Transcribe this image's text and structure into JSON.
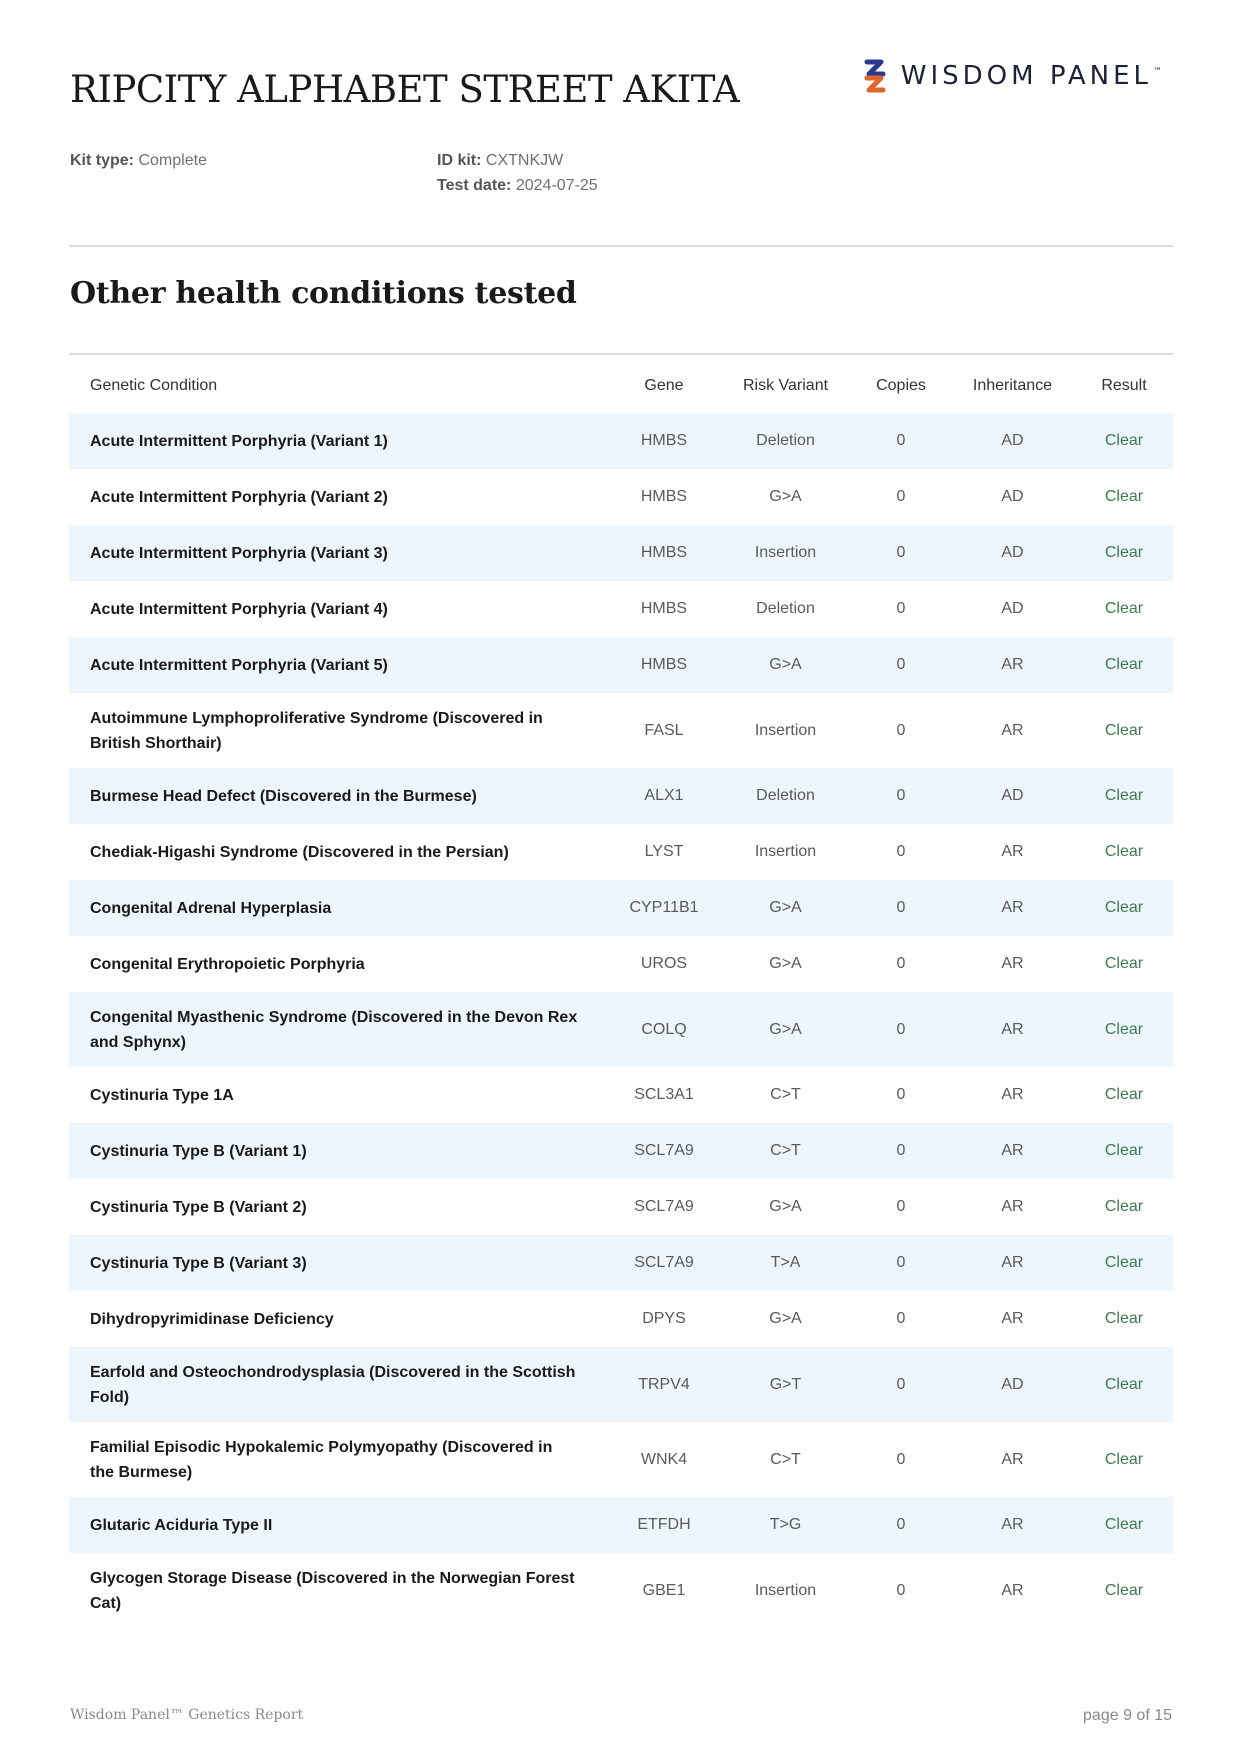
{
  "header": {
    "pet_name": "RIPCITY ALPHABET STREET AKITA",
    "logo_text": "WISDOM PANEL",
    "logo_tm": "™",
    "logo_icon": "wisdom-panel-logo-mark"
  },
  "meta": {
    "kit_type_label": "Kit type:",
    "kit_type_value": "Complete",
    "id_kit_label": "ID kit:",
    "id_kit_value": "CXTNKJW",
    "test_date_label": "Test date:",
    "test_date_value": "2024-07-25"
  },
  "section": {
    "title": "Other health conditions tested"
  },
  "table": {
    "headers": {
      "condition": "Genetic Condition",
      "gene": "Gene",
      "risk_variant": "Risk Variant",
      "copies": "Copies",
      "inheritance": "Inheritance",
      "result": "Result"
    },
    "rows": [
      {
        "condition": "Acute Intermittent Porphyria (Variant 1)",
        "gene": "HMBS",
        "risk_variant": "Deletion",
        "copies": "0",
        "inheritance": "AD",
        "result": "Clear"
      },
      {
        "condition": "Acute Intermittent Porphyria (Variant 2)",
        "gene": "HMBS",
        "risk_variant": "G>A",
        "copies": "0",
        "inheritance": "AD",
        "result": "Clear"
      },
      {
        "condition": "Acute Intermittent Porphyria (Variant 3)",
        "gene": "HMBS",
        "risk_variant": "Insertion",
        "copies": "0",
        "inheritance": "AD",
        "result": "Clear"
      },
      {
        "condition": "Acute Intermittent Porphyria (Variant 4)",
        "gene": "HMBS",
        "risk_variant": "Deletion",
        "copies": "0",
        "inheritance": "AD",
        "result": "Clear"
      },
      {
        "condition": "Acute Intermittent Porphyria (Variant 5)",
        "gene": "HMBS",
        "risk_variant": "G>A",
        "copies": "0",
        "inheritance": "AR",
        "result": "Clear"
      },
      {
        "condition": "Autoimmune Lymphoproliferative Syndrome (Discovered in British Shorthair)",
        "gene": "FASL",
        "risk_variant": "Insertion",
        "copies": "0",
        "inheritance": "AR",
        "result": "Clear"
      },
      {
        "condition": "Burmese Head Defect (Discovered in the Burmese)",
        "gene": "ALX1",
        "risk_variant": "Deletion",
        "copies": "0",
        "inheritance": "AD",
        "result": "Clear"
      },
      {
        "condition": "Chediak-Higashi Syndrome (Discovered in the Persian)",
        "gene": "LYST",
        "risk_variant": "Insertion",
        "copies": "0",
        "inheritance": "AR",
        "result": "Clear"
      },
      {
        "condition": "Congenital Adrenal Hyperplasia",
        "gene": "CYP11B1",
        "risk_variant": "G>A",
        "copies": "0",
        "inheritance": "AR",
        "result": "Clear"
      },
      {
        "condition": "Congenital Erythropoietic Porphyria",
        "gene": "UROS",
        "risk_variant": "G>A",
        "copies": "0",
        "inheritance": "AR",
        "result": "Clear"
      },
      {
        "condition": "Congenital Myasthenic Syndrome (Discovered in the Devon Rex and Sphynx)",
        "gene": "COLQ",
        "risk_variant": "G>A",
        "copies": "0",
        "inheritance": "AR",
        "result": "Clear"
      },
      {
        "condition": "Cystinuria Type 1A",
        "gene": "SCL3A1",
        "risk_variant": "C>T",
        "copies": "0",
        "inheritance": "AR",
        "result": "Clear"
      },
      {
        "condition": "Cystinuria Type B (Variant 1)",
        "gene": "SCL7A9",
        "risk_variant": "C>T",
        "copies": "0",
        "inheritance": "AR",
        "result": "Clear"
      },
      {
        "condition": "Cystinuria Type B (Variant 2)",
        "gene": "SCL7A9",
        "risk_variant": "G>A",
        "copies": "0",
        "inheritance": "AR",
        "result": "Clear"
      },
      {
        "condition": "Cystinuria Type B (Variant 3)",
        "gene": "SCL7A9",
        "risk_variant": "T>A",
        "copies": "0",
        "inheritance": "AR",
        "result": "Clear"
      },
      {
        "condition": "Dihydropyrimidinase Deficiency",
        "gene": "DPYS",
        "risk_variant": "G>A",
        "copies": "0",
        "inheritance": "AR",
        "result": "Clear"
      },
      {
        "condition": "Earfold and Osteochondrodysplasia (Discovered in the Scottish Fold)",
        "gene": "TRPV4",
        "risk_variant": "G>T",
        "copies": "0",
        "inheritance": "AD",
        "result": "Clear"
      },
      {
        "condition": "Familial Episodic Hypokalemic Polymyopathy (Discovered in the Burmese)",
        "gene": "WNK4",
        "risk_variant": "C>T",
        "copies": "0",
        "inheritance": "AR",
        "result": "Clear"
      },
      {
        "condition": "Glutaric Aciduria Type II",
        "gene": "ETFDH",
        "risk_variant": "T>G",
        "copies": "0",
        "inheritance": "AR",
        "result": "Clear"
      },
      {
        "condition": "Glycogen Storage Disease (Discovered in the Norwegian Forest Cat)",
        "gene": "GBE1",
        "risk_variant": "Insertion",
        "copies": "0",
        "inheritance": "AR",
        "result": "Clear"
      }
    ]
  },
  "colors": {
    "shaded_row": "#eef6fd",
    "result_clear": "#3d7a4f",
    "logo_orange": "#e0652b",
    "logo_navy": "#2b3a8c"
  },
  "footer": {
    "left": "Wisdom Panel™ Genetics Report",
    "right": "page 9 of 15"
  }
}
